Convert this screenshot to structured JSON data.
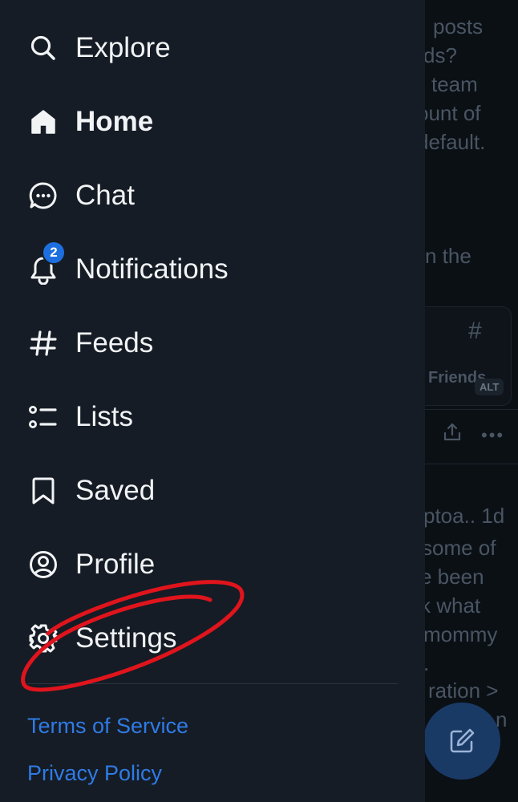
{
  "background_feed": {
    "text_fragments": [
      "posts",
      "ds?",
      "team",
      "ount of",
      "default.",
      "n the",
      "ptoa.. 1d",
      "some of",
      "e been",
      "k what",
      "mommy",
      ".",
      "ration >",
      "n"
    ],
    "card_hash": "#",
    "card_title": "Friends",
    "card_alt": "ALT",
    "more_dots": "•••"
  },
  "drawer": {
    "items": [
      {
        "label": "Explore",
        "icon": "search-icon"
      },
      {
        "label": "Home",
        "icon": "home-icon"
      },
      {
        "label": "Chat",
        "icon": "chat-icon"
      },
      {
        "label": "Notifications",
        "icon": "bell-icon",
        "badge": "2"
      },
      {
        "label": "Feeds",
        "icon": "hash-icon"
      },
      {
        "label": "Lists",
        "icon": "list-icon"
      },
      {
        "label": "Saved",
        "icon": "bookmark-icon"
      },
      {
        "label": "Profile",
        "icon": "user-circle-icon"
      },
      {
        "label": "Settings",
        "icon": "gear-icon"
      }
    ],
    "footer": {
      "terms": "Terms of Service",
      "privacy": "Privacy Policy"
    }
  },
  "fab": {
    "icon": "compose-icon"
  },
  "colors": {
    "drawer_bg": "#151c25",
    "text": "#f1f3f5",
    "link": "#2f7be6",
    "badge": "#1d6fe0",
    "annotation": "#e0141c"
  }
}
